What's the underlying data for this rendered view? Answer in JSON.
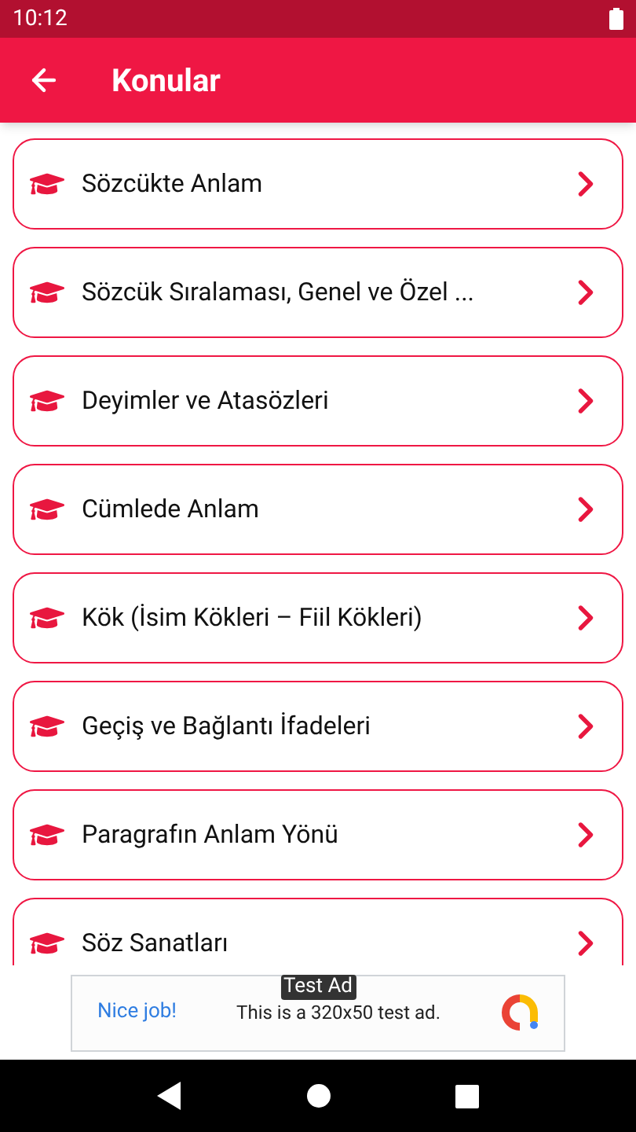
{
  "status_bar": {
    "time": "10:12"
  },
  "app_bar": {
    "title": "Konular"
  },
  "topics": [
    {
      "label": "Sözcükte Anlam"
    },
    {
      "label": "Sözcük Sıralaması, Genel ve Özel ..."
    },
    {
      "label": "Deyimler ve Atasözleri"
    },
    {
      "label": "Cümlede Anlam"
    },
    {
      "label": "Kök (İsim Kökleri – Fiil Kökleri)"
    },
    {
      "label": "Geçiş ve Bağlantı İfadeleri"
    },
    {
      "label": "Paragrafın Anlam Yönü"
    },
    {
      "label": "Söz Sanatları"
    }
  ],
  "ad": {
    "badge": "Test Ad",
    "headline": "Nice job!",
    "text": "This is a 320x50 test ad."
  }
}
